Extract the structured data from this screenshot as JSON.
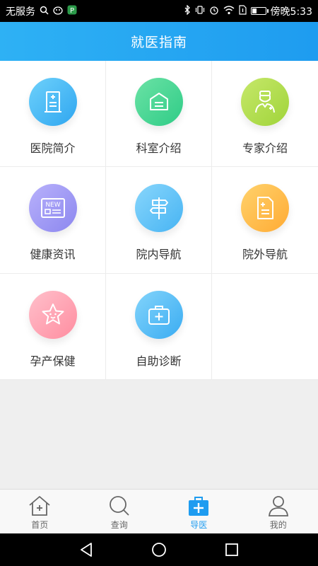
{
  "status": {
    "carrier": "无服务",
    "time": "傍晚5:33"
  },
  "header": {
    "title": "就医指南"
  },
  "grid": [
    {
      "label": "医院简介",
      "icon": "hospital-building-icon",
      "color": "#2fa6f0"
    },
    {
      "label": "科室介绍",
      "icon": "department-box-icon",
      "color": "#2fcc87"
    },
    {
      "label": "专家介绍",
      "icon": "doctor-icon",
      "color": "#a0d43a"
    },
    {
      "label": "健康资讯",
      "icon": "news-icon",
      "color": "#8c87ef"
    },
    {
      "label": "院内导航",
      "icon": "signpost-icon",
      "color": "#47b4f3"
    },
    {
      "label": "院外导航",
      "icon": "document-icon",
      "color": "#ffab34"
    },
    {
      "label": "孕产保健",
      "icon": "star-face-icon",
      "color": "#ff8da0"
    },
    {
      "label": "自助诊断",
      "icon": "medical-kit-icon",
      "color": "#3aacf2"
    }
  ],
  "news_badge": "NEW",
  "tabbar": [
    {
      "label": "首页",
      "icon": "home-icon"
    },
    {
      "label": "查询",
      "icon": "search-icon"
    },
    {
      "label": "导医",
      "icon": "medical-kit-icon",
      "active": true
    },
    {
      "label": "我的",
      "icon": "user-icon"
    }
  ],
  "colors": {
    "accent": "#1e9cf0"
  }
}
